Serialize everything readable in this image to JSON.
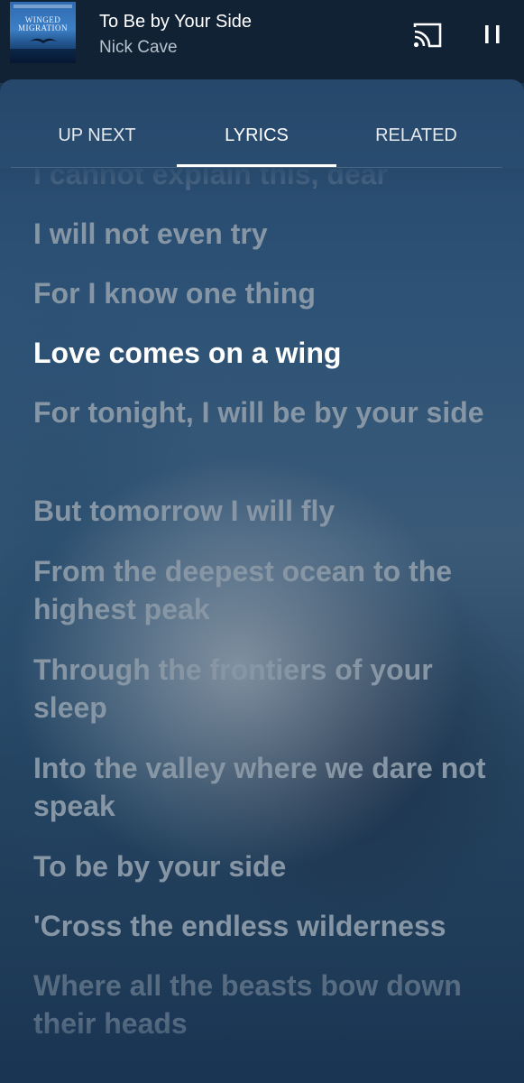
{
  "now_playing": {
    "title": "To Be by Your Side",
    "artist": "Nick Cave",
    "album_art_text": "WINGED MIGRATION",
    "cast_icon": "cast-icon",
    "pause_icon": "pause-icon"
  },
  "tabs": [
    {
      "label": "UP NEXT",
      "active": false
    },
    {
      "label": "LYRICS",
      "active": true
    },
    {
      "label": "RELATED",
      "active": false
    }
  ],
  "lyrics": {
    "current_index": 3,
    "lines": [
      "I cannot explain this, dear",
      "I will not even try",
      "For I know one thing",
      "Love comes on a wing",
      "For tonight, I will be by your side",
      "But tomorrow I will fly",
      "From the deepest ocean to the highest peak",
      "Through the frontiers of your sleep",
      "Into the valley where we dare not speak",
      "To be by your side",
      "'Cross the endless wilderness",
      "Where all the beasts bow down their heads"
    ]
  },
  "colors": {
    "mini_player_bg": "#112235",
    "active_text": "#ffffff",
    "inactive_lyric": "#8796a5"
  }
}
